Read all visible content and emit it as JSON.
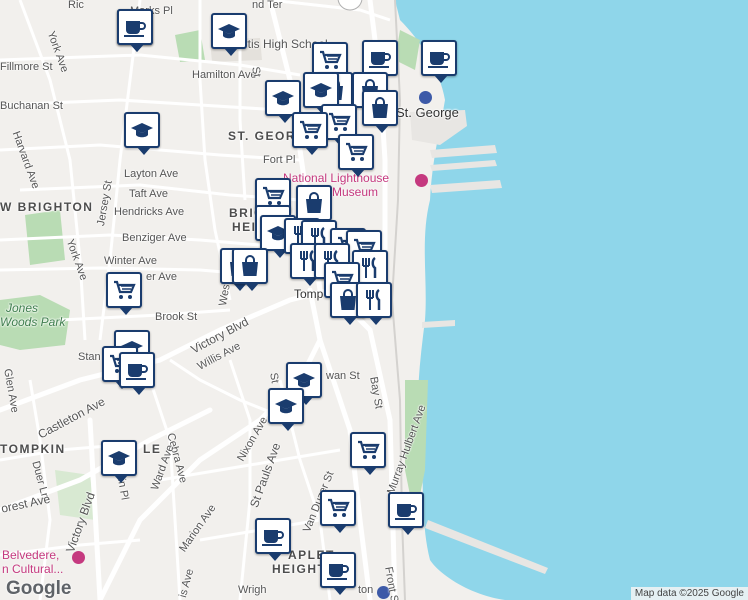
{
  "map": {
    "attribution": "Map data ©2025 Google",
    "logo": "Google",
    "colors": {
      "water": "#8fd6ea",
      "land": "#f2f0ed",
      "park": "#b9dcb4",
      "road": "#ffffff",
      "pin_border": "#1a3c6e",
      "poi_label": "#c5397f"
    },
    "labels": {
      "marks_pl": "Marks Pl",
      "richmond_ter": "Ric",
      "bend_ter": "nd Ter",
      "curtis_hs": "urtis High School",
      "york_ave": "York Ave",
      "fillmore": "Fillmore St",
      "buchanan": "Buchanan St",
      "hamilton": "Hamilton Ave",
      "harvard": "Harvard Ave",
      "st_george": "ST. GEORGE",
      "st_george_terminal": "St. George",
      "fort_pl": "Fort Pl",
      "layton": "Layton Ave",
      "taft": "Taft Ave",
      "jersey": "Jersey St",
      "national_lighthouse_1": "National Lighthouse",
      "national_lighthouse_2": "Museum",
      "new_brighton": "W BRIGHTON",
      "hendricks": "Hendricks Ave",
      "brighton_heights_1": "BRIG",
      "brighton_heights_2": "HEIG",
      "benziger": "Benziger Ave",
      "york_ave_2": "York Ave",
      "winter": "Winter Ave",
      "er_ave": "er Ave",
      "west_ave": "West Ave",
      "jones_woods_1": "Jones",
      "jones_woods_2": "Woods Park",
      "tomp": "Tomp",
      "brook": "Brook St",
      "victory_blvd": "Victory Blvd",
      "willis": "Willis Ave",
      "stan": "Stan",
      "van_st": "wan St",
      "glen": "Glen Ave",
      "castleton": "Castleton Ave",
      "bay_st": "Bay St",
      "tompkinsville": "TOMPKIN",
      "le": "LE",
      "cebra": "Cebra Ave",
      "nixon": "Nixon Ave",
      "st_pauls": "St Pauls Ave",
      "van_duzer": "Van Duzer St",
      "murray_hulbert": "Murray Hulbert Ave",
      "duer": "Duer Ln",
      "victory_blvd_2": "Victory Blvd",
      "ward": "Ward Ave",
      "forest": "orest Ave",
      "in_pl": "in Pl",
      "marion": "Marion Ave",
      "belvedere_1": "Belvedere,",
      "belvedere_2": "n Cultural...",
      "apleton": "APLET",
      "heights": "HEIGHT",
      "is_ave": "is Ave",
      "wright": "Wrigh",
      "ton": "ton",
      "front_st": "Front St",
      "st_lbl": "St"
    },
    "pins": [
      {
        "icon": "grocery-cart"
      },
      {
        "icon": "school-cap"
      },
      {
        "icon": "grocery-cart"
      },
      {
        "icon": "cafe-cup"
      },
      {
        "icon": "cafe-cup"
      },
      {
        "icon": "shopping-bag"
      },
      {
        "icon": "school-cap"
      },
      {
        "icon": "school-cap"
      },
      {
        "icon": "shopping-bag"
      },
      {
        "icon": "shopping-bag"
      },
      {
        "icon": "school-cap"
      },
      {
        "icon": "grocery-cart"
      },
      {
        "icon": "grocery-cart"
      },
      {
        "icon": "grocery-cart"
      },
      {
        "icon": "grocery-cart"
      },
      {
        "icon": "school-cap"
      },
      {
        "icon": "shopping-bag"
      },
      {
        "icon": "school-cap"
      },
      {
        "icon": "restaurant-fork-knife"
      },
      {
        "icon": "restaurant-fork-knife"
      },
      {
        "icon": "grocery-cart"
      },
      {
        "icon": "grocery-cart"
      },
      {
        "icon": "shopping-bag"
      },
      {
        "icon": "shopping-bag"
      },
      {
        "icon": "restaurant-fork-knife"
      },
      {
        "icon": "restaurant-fork-knife"
      },
      {
        "icon": "restaurant-fork-knife"
      },
      {
        "icon": "grocery-cart"
      },
      {
        "icon": "shopping-bag"
      },
      {
        "icon": "restaurant-fork-knife"
      },
      {
        "icon": "grocery-cart"
      },
      {
        "icon": "school-cap"
      },
      {
        "icon": "grocery-cart"
      },
      {
        "icon": "cafe-cup"
      },
      {
        "icon": "school-cap"
      },
      {
        "icon": "school-cap"
      },
      {
        "icon": "school-cap"
      },
      {
        "icon": "grocery-cart"
      },
      {
        "icon": "grocery-cart"
      },
      {
        "icon": "cafe-cup"
      },
      {
        "icon": "cafe-cup"
      },
      {
        "icon": "cafe-cup"
      },
      {
        "icon": "cafe-cup"
      }
    ]
  }
}
